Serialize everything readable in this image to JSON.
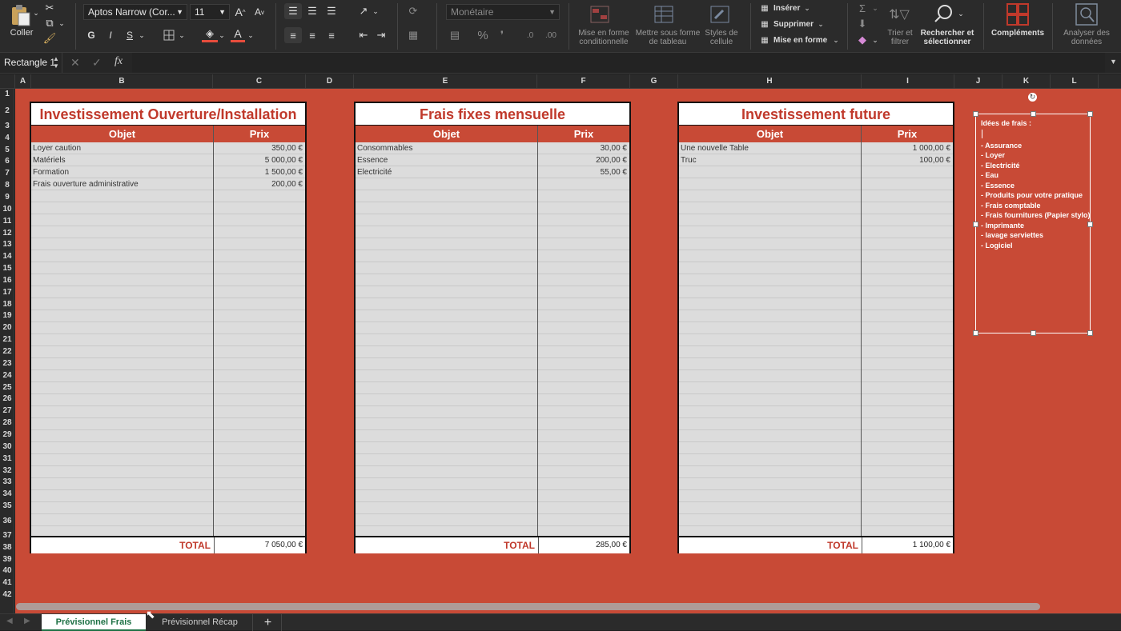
{
  "ribbon": {
    "clipboard": {
      "paste_label": "Coller"
    },
    "font": {
      "family": "Aptos Narrow (Cor...",
      "size": "11",
      "bold": "G",
      "italic": "I",
      "underline": "S"
    },
    "number": {
      "format": "Monétaire",
      "percent": "%"
    },
    "styles": {
      "conditional": "Mise en forme conditionnelle",
      "as_table": "Mettre sous forme de tableau",
      "cell_styles": "Styles de cellule"
    },
    "cells": {
      "insert": "Insérer",
      "delete": "Supprimer",
      "format": "Mise en forme"
    },
    "editing": {
      "sort_filter": "Trier et filtrer",
      "find_select": "Rechercher et sélectionner"
    },
    "addins": "Compléments",
    "analyze": "Analyser des données"
  },
  "formula_bar": {
    "name_box": "Rectangle 1",
    "fx": "fx",
    "content": ""
  },
  "columns": [
    "A",
    "B",
    "C",
    "D",
    "E",
    "F",
    "G",
    "H",
    "I",
    "J",
    "K",
    "L"
  ],
  "rows": [
    "1",
    "2",
    "3",
    "4",
    "5",
    "6",
    "7",
    "8",
    "9",
    "10",
    "11",
    "12",
    "13",
    "14",
    "15",
    "16",
    "17",
    "18",
    "19",
    "20",
    "21",
    "22",
    "23",
    "24",
    "25",
    "26",
    "27",
    "28",
    "29",
    "30",
    "31",
    "32",
    "33",
    "34",
    "35",
    "36",
    "37",
    "38",
    "39",
    "40",
    "41",
    "42"
  ],
  "tables": [
    {
      "title": "Investissement Ouverture/Installation",
      "col_object": "Objet",
      "col_price": "Prix",
      "rows": [
        {
          "item": "Loyer caution",
          "price": "350,00 €"
        },
        {
          "item": "Matériels",
          "price": "5 000,00 €"
        },
        {
          "item": "Formation",
          "price": "1 500,00 €"
        },
        {
          "item": "Frais ouverture administrative",
          "price": "200,00 €"
        }
      ],
      "total_label": "TOTAL",
      "total_value": "7 050,00 €"
    },
    {
      "title": "Frais fixes mensuelle",
      "col_object": "Objet",
      "col_price": "Prix",
      "rows": [
        {
          "item": "Consommables",
          "price": "30,00 €"
        },
        {
          "item": "Essence",
          "price": "200,00 €"
        },
        {
          "item": "Electricité",
          "price": "55,00 €"
        }
      ],
      "total_label": "TOTAL",
      "total_value": "285,00 €"
    },
    {
      "title": "Investissement future",
      "col_object": "Objet",
      "col_price": "Prix",
      "rows": [
        {
          "item": "Une nouvelle Table",
          "price": "1 000,00 €"
        },
        {
          "item": "Truc",
          "price": "100,00 €"
        }
      ],
      "total_label": "TOTAL",
      "total_value": "1 100,00 €"
    }
  ],
  "shape": {
    "heading": "Idées de frais :",
    "items": [
      "- Assurance",
      "- Loyer",
      "- Electricité",
      "- Eau",
      "- Essence",
      "- Produits pour votre pratique",
      "- Frais comptable",
      "- Frais fournitures (Papier stylo)",
      "- Imprimante",
      "- lavage serviettes",
      "- Logiciel"
    ]
  },
  "sheets": {
    "active": "Prévisionnel Frais",
    "other": "Prévisionnel Récap",
    "add": "+"
  },
  "colors": {
    "sheet_bg": "#c84a36",
    "title_red": "#c0392b",
    "active_tab_text": "#1e7145"
  }
}
